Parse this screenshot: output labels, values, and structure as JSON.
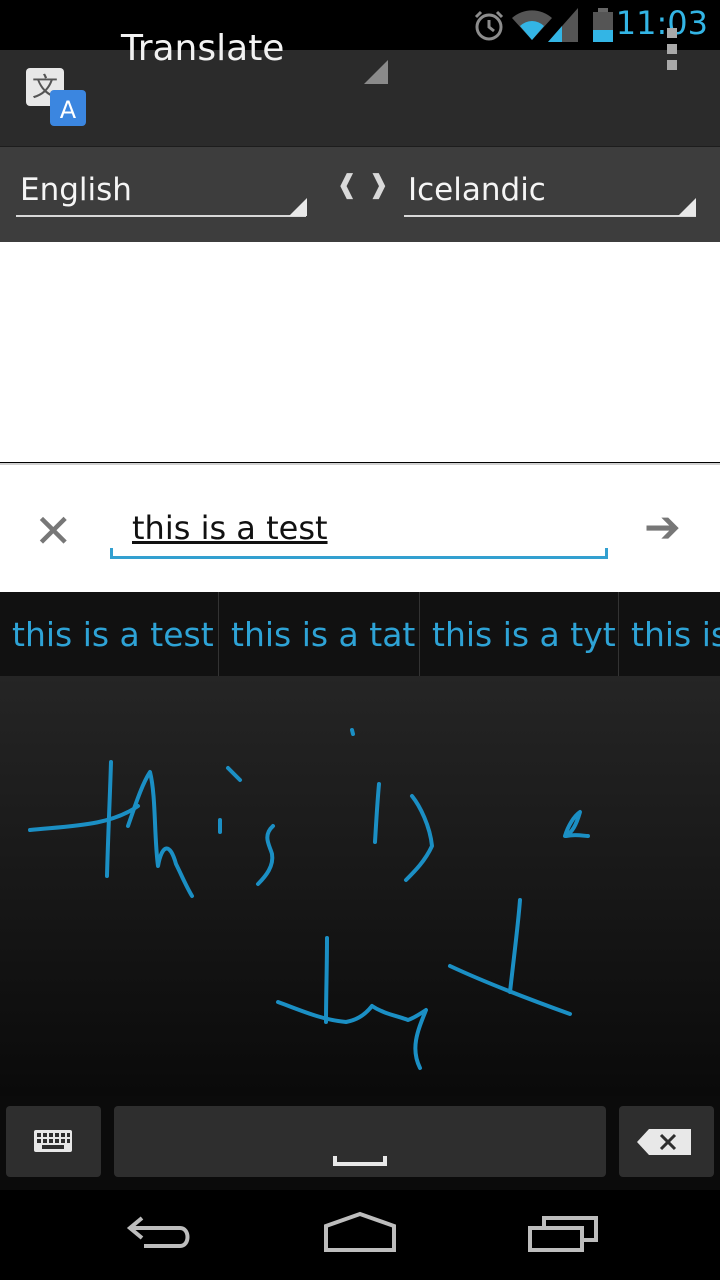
{
  "status_bar": {
    "time": "11:03",
    "icons": [
      "alarm-icon",
      "wifi-icon",
      "signal-icon",
      "battery-icon"
    ]
  },
  "action_bar": {
    "title": "Translate",
    "app_icon": "translate-app-icon",
    "overflow_icon": "overflow-menu-icon"
  },
  "languages": {
    "source": "English",
    "target": "Icelandic",
    "swap_icon": "swap-languages-icon"
  },
  "input": {
    "value": "this is a test",
    "clear_icon": "clear-icon",
    "submit_icon": "arrow-right-icon"
  },
  "suggestions": [
    "this is a test",
    "this is a tat",
    "this is a tyt",
    "this is a test"
  ],
  "keyboard": {
    "left_key_icon": "keyboard-icon",
    "space_icon": "space-icon",
    "delete_icon": "backspace-icon"
  },
  "nav_bar": [
    "back-icon",
    "home-icon",
    "recent-apps-icon"
  ],
  "colors": {
    "accent": "#33b5e5",
    "ink": "#1b8fc4",
    "action_bar": "#2b2b2b",
    "language_bar": "#3d3d3d"
  }
}
